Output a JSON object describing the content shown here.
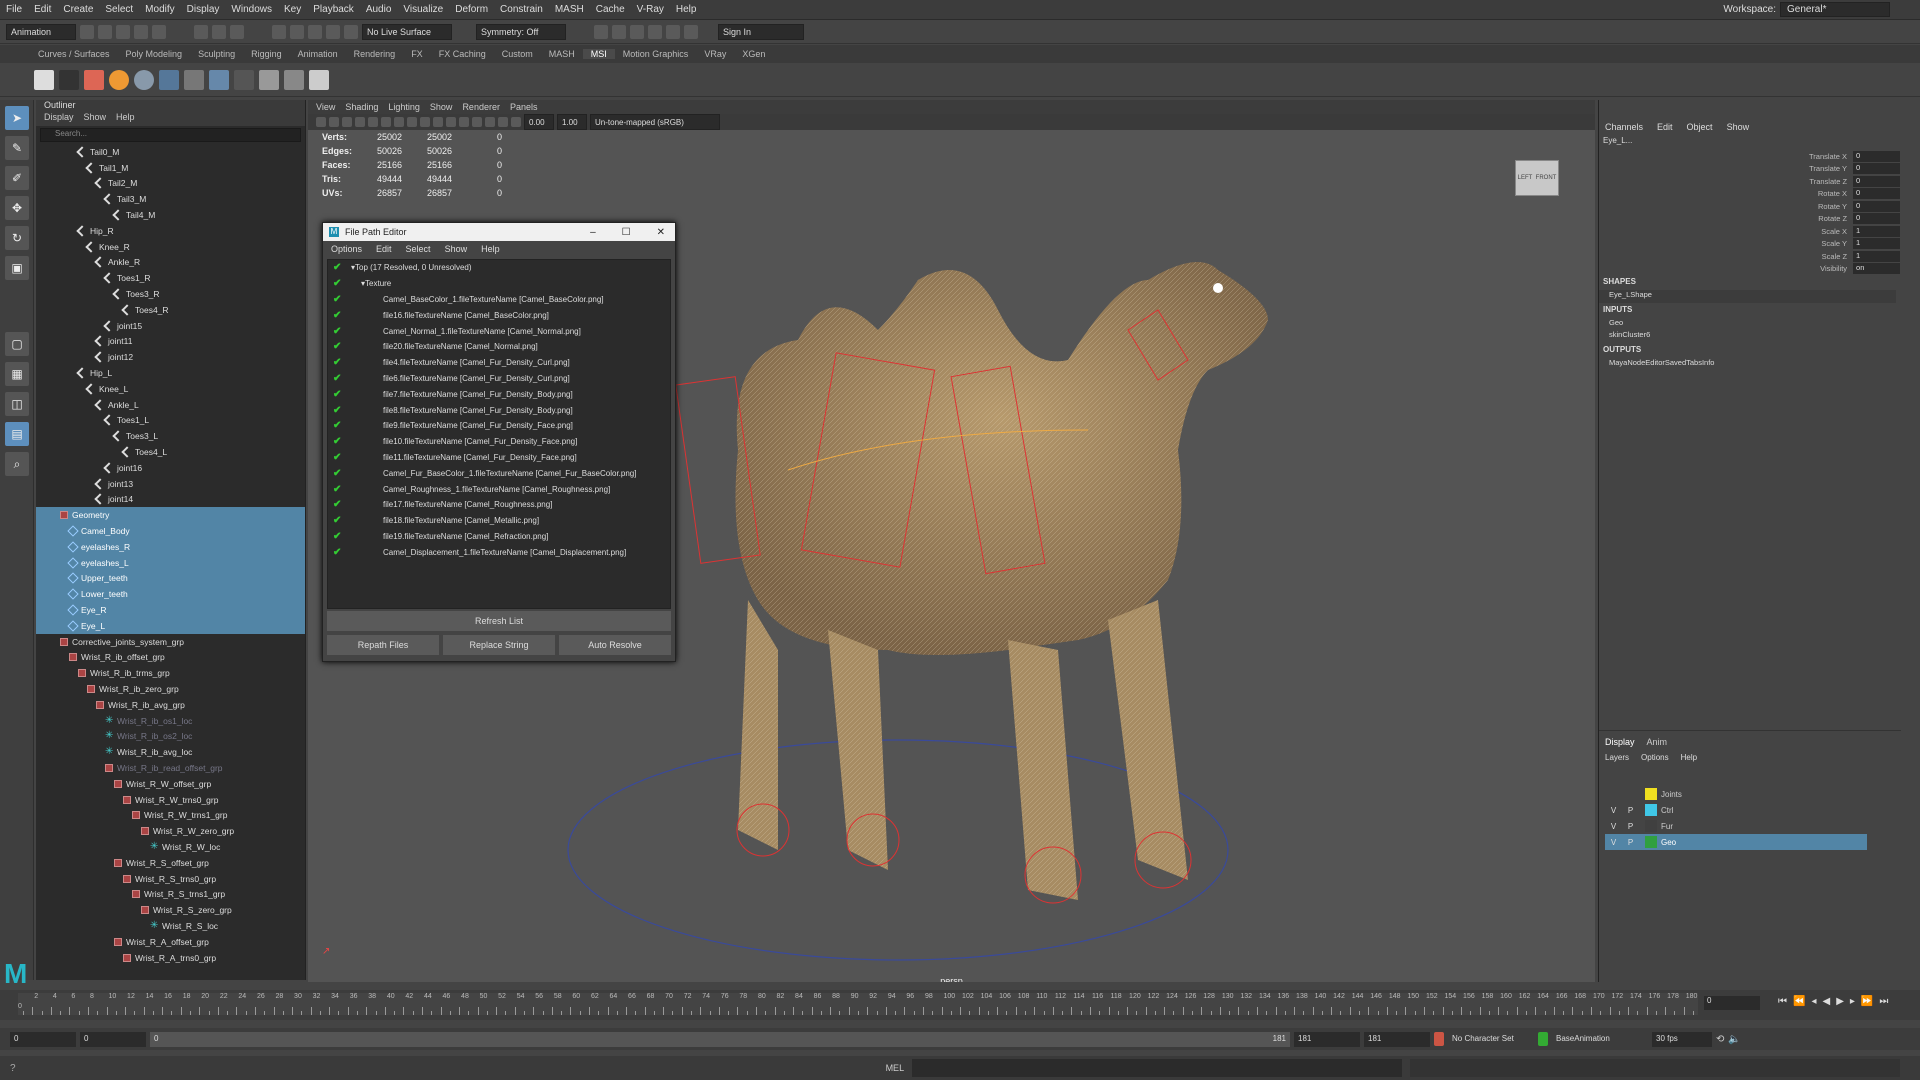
{
  "menubar": {
    "items": [
      "File",
      "Edit",
      "Create",
      "Select",
      "Modify",
      "Display",
      "Windows",
      "Key",
      "Playback",
      "Audio",
      "Visualize",
      "Deform",
      "Constrain",
      "MASH",
      "Cache",
      "V-Ray",
      "Help"
    ],
    "workspace_label": "Workspace:",
    "workspace_value": "General*"
  },
  "statusline": {
    "menuset": "Animation",
    "live_surface": "No Live Surface",
    "symmetry": "Symmetry: Off",
    "sign_in": "Sign In"
  },
  "shelf": {
    "tabs": [
      "Curves / Surfaces",
      "Poly Modeling",
      "Sculpting",
      "Rigging",
      "Animation",
      "Rendering",
      "FX",
      "FX Caching",
      "Custom",
      "MASH",
      "MSI",
      "Motion Graphics",
      "VRay",
      "XGen"
    ],
    "active_tab": "MSI"
  },
  "outliner": {
    "title": "Outliner",
    "menu": [
      "Display",
      "Show",
      "Help"
    ],
    "search_placeholder": "Search...",
    "rows": [
      {
        "label": "Tail0_M",
        "indent": 4,
        "icon": "jt"
      },
      {
        "label": "Tail1_M",
        "indent": 5,
        "icon": "jt"
      },
      {
        "label": "Tail2_M",
        "indent": 6,
        "icon": "jt"
      },
      {
        "label": "Tail3_M",
        "indent": 7,
        "icon": "jt"
      },
      {
        "label": "Tail4_M",
        "indent": 8,
        "icon": "jt"
      },
      {
        "label": "Hip_R",
        "indent": 4,
        "icon": "jt"
      },
      {
        "label": "Knee_R",
        "indent": 5,
        "icon": "jt"
      },
      {
        "label": "Ankle_R",
        "indent": 6,
        "icon": "jt"
      },
      {
        "label": "Toes1_R",
        "indent": 7,
        "icon": "jt"
      },
      {
        "label": "Toes3_R",
        "indent": 8,
        "icon": "jt"
      },
      {
        "label": "Toes4_R",
        "indent": 9,
        "icon": "jt"
      },
      {
        "label": "joint15",
        "indent": 7,
        "icon": "jt"
      },
      {
        "label": "joint11",
        "indent": 6,
        "icon": "jt"
      },
      {
        "label": "joint12",
        "indent": 6,
        "icon": "jt"
      },
      {
        "label": "Hip_L",
        "indent": 4,
        "icon": "jt"
      },
      {
        "label": "Knee_L",
        "indent": 5,
        "icon": "jt"
      },
      {
        "label": "Ankle_L",
        "indent": 6,
        "icon": "jt"
      },
      {
        "label": "Toes1_L",
        "indent": 7,
        "icon": "jt"
      },
      {
        "label": "Toes3_L",
        "indent": 8,
        "icon": "jt"
      },
      {
        "label": "Toes4_L",
        "indent": 9,
        "icon": "jt"
      },
      {
        "label": "joint16",
        "indent": 7,
        "icon": "jt"
      },
      {
        "label": "joint13",
        "indent": 6,
        "icon": "jt"
      },
      {
        "label": "joint14",
        "indent": 6,
        "icon": "jt"
      },
      {
        "label": "Geometry",
        "indent": 2,
        "icon": "grp",
        "sel": true
      },
      {
        "label": "Camel_Body",
        "indent": 3,
        "icon": "geo",
        "sel": true
      },
      {
        "label": "eyelashes_R",
        "indent": 3,
        "icon": "geo",
        "sel": true
      },
      {
        "label": "eyelashes_L",
        "indent": 3,
        "icon": "geo",
        "sel": true
      },
      {
        "label": "Upper_teeth",
        "indent": 3,
        "icon": "geo",
        "sel": true
      },
      {
        "label": "Lower_teeth",
        "indent": 3,
        "icon": "geo",
        "sel": true
      },
      {
        "label": "Eye_R",
        "indent": 3,
        "icon": "geo",
        "sel": true
      },
      {
        "label": "Eye_L",
        "indent": 3,
        "icon": "geo",
        "sel": true
      },
      {
        "label": "Corrective_joints_system_grp",
        "indent": 2,
        "icon": "grp"
      },
      {
        "label": "Wrist_R_ib_offset_grp",
        "indent": 3,
        "icon": "grp"
      },
      {
        "label": "Wrist_R_ib_trms_grp",
        "indent": 4,
        "icon": "grp"
      },
      {
        "label": "Wrist_R_ib_zero_grp",
        "indent": 5,
        "icon": "grp"
      },
      {
        "label": "Wrist_R_ib_avg_grp",
        "indent": 6,
        "icon": "grp"
      },
      {
        "label": "Wrist_R_ib_os1_loc",
        "indent": 7,
        "icon": "loc",
        "dim": true
      },
      {
        "label": "Wrist_R_ib_os2_loc",
        "indent": 7,
        "icon": "loc",
        "dim": true
      },
      {
        "label": "Wrist_R_ib_avg_loc",
        "indent": 7,
        "icon": "loc"
      },
      {
        "label": "Wrist_R_ib_read_offset_grp",
        "indent": 7,
        "icon": "grp",
        "dim": true
      },
      {
        "label": "Wrist_R_W_offset_grp",
        "indent": 8,
        "icon": "grp"
      },
      {
        "label": "Wrist_R_W_trns0_grp",
        "indent": 9,
        "icon": "grp"
      },
      {
        "label": "Wrist_R_W_trns1_grp",
        "indent": 10,
        "icon": "grp"
      },
      {
        "label": "Wrist_R_W_zero_grp",
        "indent": 11,
        "icon": "grp"
      },
      {
        "label": "Wrist_R_W_loc",
        "indent": 12,
        "icon": "loc"
      },
      {
        "label": "Wrist_R_S_offset_grp",
        "indent": 8,
        "icon": "grp"
      },
      {
        "label": "Wrist_R_S_trns0_grp",
        "indent": 9,
        "icon": "grp"
      },
      {
        "label": "Wrist_R_S_trns1_grp",
        "indent": 10,
        "icon": "grp"
      },
      {
        "label": "Wrist_R_S_zero_grp",
        "indent": 11,
        "icon": "grp"
      },
      {
        "label": "Wrist_R_S_loc",
        "indent": 12,
        "icon": "loc"
      },
      {
        "label": "Wrist_R_A_offset_grp",
        "indent": 8,
        "icon": "grp"
      },
      {
        "label": "Wrist_R_A_trns0_grp",
        "indent": 9,
        "icon": "grp"
      }
    ]
  },
  "viewport": {
    "menu": [
      "View",
      "Shading",
      "Lighting",
      "Show",
      "Renderer",
      "Panels"
    ],
    "exposure": "0.00",
    "gamma": "1.00",
    "colorspace": "Un-tone-mapped (sRGB)",
    "camera": "persp",
    "hud": [
      [
        "Verts:",
        "25002",
        "25002",
        "0"
      ],
      [
        "Edges:",
        "50026",
        "50026",
        "0"
      ],
      [
        "Faces:",
        "25166",
        "25166",
        "0"
      ],
      [
        "Tris:",
        "49444",
        "49444",
        "0"
      ],
      [
        "UVs:",
        "26857",
        "26857",
        "0"
      ]
    ],
    "viewcube": [
      "LEFT",
      "FRONT"
    ]
  },
  "fpe": {
    "title": "File Path Editor",
    "menu": [
      "Options",
      "Edit",
      "Select",
      "Show",
      "Help"
    ],
    "root": "Top (17 Resolved, 0 Unresolved)",
    "group": "Texture",
    "files": [
      "Camel_BaseColor_1.fileTextureName [Camel_BaseColor.png]",
      "file16.fileTextureName [Camel_BaseColor.png]",
      "Camel_Normal_1.fileTextureName [Camel_Normal.png]",
      "file20.fileTextureName [Camel_Normal.png]",
      "file4.fileTextureName [Camel_Fur_Density_Curl.png]",
      "file6.fileTextureName [Camel_Fur_Density_Curl.png]",
      "file7.fileTextureName [Camel_Fur_Density_Body.png]",
      "file8.fileTextureName [Camel_Fur_Density_Body.png]",
      "file9.fileTextureName [Camel_Fur_Density_Face.png]",
      "file10.fileTextureName [Camel_Fur_Density_Face.png]",
      "file11.fileTextureName [Camel_Fur_Density_Face.png]",
      "Camel_Fur_BaseColor_1.fileTextureName [Camel_Fur_BaseColor.png]",
      "Camel_Roughness_1.fileTextureName [Camel_Roughness.png]",
      "file17.fileTextureName [Camel_Roughness.png]",
      "file18.fileTextureName [Camel_Metallic.png]",
      "file19.fileTextureName [Camel_Refraction.png]",
      "Camel_Displacement_1.fileTextureName [Camel_Displacement.png]"
    ],
    "refresh": "Refresh List",
    "repath": "Repath Files",
    "replace": "Replace String",
    "auto": "Auto Resolve"
  },
  "channelbox": {
    "menu": [
      "Channels",
      "Edit",
      "Object",
      "Show"
    ],
    "object": "Eye_L...",
    "attrs": [
      [
        "Translate X",
        "0"
      ],
      [
        "Translate Y",
        "0"
      ],
      [
        "Translate Z",
        "0"
      ],
      [
        "Rotate X",
        "0"
      ],
      [
        "Rotate Y",
        "0"
      ],
      [
        "Rotate Z",
        "0"
      ],
      [
        "Scale X",
        "1"
      ],
      [
        "Scale Y",
        "1"
      ],
      [
        "Scale Z",
        "1"
      ],
      [
        "Visibility",
        "on"
      ]
    ],
    "shapes_label": "SHAPES",
    "shapes": [
      "Eye_LShape"
    ],
    "inputs_label": "INPUTS",
    "inputs": [
      "Geo",
      "skinCluster6"
    ],
    "outputs_label": "OUTPUTS",
    "outputs": [
      "MayaNodeEditorSavedTabsInfo"
    ]
  },
  "layers": {
    "tabs": [
      "Display",
      "Anim"
    ],
    "menu": [
      "Layers",
      "Options",
      "Help"
    ],
    "rows": [
      {
        "v": "",
        "p": "",
        "name": "Joints",
        "color": "#f0e020"
      },
      {
        "v": "V",
        "p": "P",
        "name": "Ctrl",
        "color": "#40c8e8"
      },
      {
        "v": "V",
        "p": "P",
        "name": "Fur",
        "color": "#404040"
      },
      {
        "v": "V",
        "p": "P",
        "name": "Geo",
        "color": "#30a040",
        "sel": true
      }
    ]
  },
  "timeline": {
    "ticks": [
      "2",
      "4",
      "6",
      "8",
      "10",
      "12",
      "14",
      "16",
      "18",
      "20",
      "22",
      "24",
      "26",
      "28",
      "30",
      "32",
      "34",
      "36",
      "38",
      "40",
      "42",
      "44",
      "46",
      "48",
      "50",
      "52",
      "54",
      "56",
      "58",
      "60",
      "62",
      "64",
      "66",
      "68",
      "70",
      "72",
      "74",
      "76",
      "78",
      "80",
      "82",
      "84",
      "86",
      "88",
      "90",
      "92",
      "94",
      "96",
      "98",
      "100",
      "102",
      "104",
      "106",
      "108",
      "110",
      "112",
      "114",
      "116",
      "118",
      "120",
      "122",
      "124",
      "126",
      "128",
      "130",
      "132",
      "134",
      "136",
      "138",
      "140",
      "142",
      "144",
      "146",
      "148",
      "150",
      "152",
      "154",
      "156",
      "158",
      "160",
      "162",
      "164",
      "166",
      "168",
      "170",
      "172",
      "174",
      "176",
      "178",
      "180"
    ],
    "current": "0",
    "left_marker": "0"
  },
  "range": {
    "start": "0",
    "start2": "0",
    "slider_start": "0",
    "slider_end": "181",
    "end": "181",
    "end2": "181",
    "char_set": "No Character Set",
    "anim_layer": "BaseAnimation",
    "fps": "30 fps"
  },
  "cmdline": {
    "lang": "MEL"
  }
}
